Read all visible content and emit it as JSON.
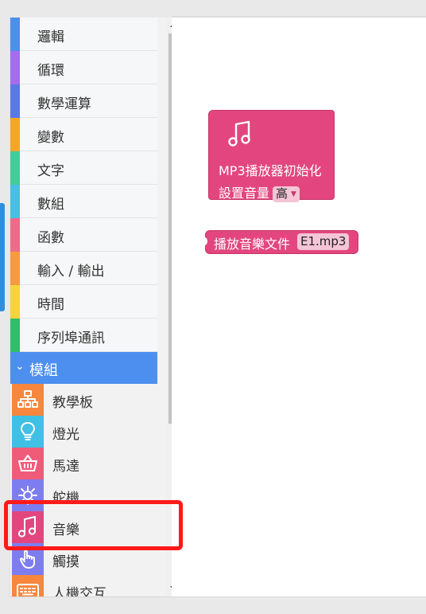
{
  "palette": {
    "categories": [
      {
        "label": "邏輯",
        "color": "#4d8fee"
      },
      {
        "label": "循環",
        "color": "#a46cf0"
      },
      {
        "label": "數學運算",
        "color": "#5a78e8"
      },
      {
        "label": "變數",
        "color": "#f5a623"
      },
      {
        "label": "文字",
        "color": "#3ecf9a"
      },
      {
        "label": "數組",
        "color": "#46c0e3"
      },
      {
        "label": "函數",
        "color": "#f06a8a"
      },
      {
        "label": "輸入 / 輸出",
        "color": "#f89a3d"
      },
      {
        "label": "時間",
        "color": "#f7d43a"
      },
      {
        "label": "序列埠通訊",
        "color": "#2fbf6a"
      }
    ],
    "module_header": "模組",
    "modules": [
      {
        "label": "教學板",
        "icon": "board-icon",
        "color": "#f6873c"
      },
      {
        "label": "燈光",
        "icon": "bulb-icon",
        "color": "#3fc0e4"
      },
      {
        "label": "馬達",
        "icon": "basket-icon",
        "color": "#f15b7a"
      },
      {
        "label": "舵機",
        "icon": "gear-icon",
        "color": "#7d7df0"
      },
      {
        "label": "音樂",
        "icon": "music-note-icon",
        "color": "#e3467e"
      },
      {
        "label": "觸摸",
        "icon": "touch-hand-icon",
        "color": "#7d7df0"
      },
      {
        "label": "人機交互",
        "icon": "keyboard-icon",
        "color": "#f6873c"
      }
    ]
  },
  "workspace": {
    "init_block": {
      "icon": "music-note-icon",
      "title": "MP3播放器初始化",
      "volume_label": "設置音量",
      "volume_value": "高"
    },
    "play_block": {
      "label": "播放音樂文件",
      "file_value": "E1.mp3"
    }
  },
  "colors": {
    "block": "#e3467e",
    "module_header": "#4d8fee",
    "highlight": "#ff1a1a"
  }
}
